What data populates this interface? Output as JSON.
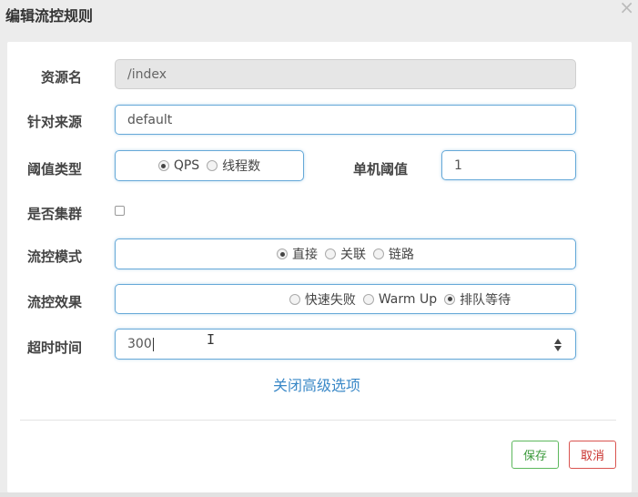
{
  "dialog": {
    "title": "编辑流控规则",
    "close_icon": "close-icon"
  },
  "form": {
    "resource": {
      "label": "资源名",
      "value": "/index"
    },
    "origin": {
      "label": "针对来源",
      "value": "default"
    },
    "threshold_type": {
      "label": "阈值类型",
      "options": [
        {
          "label": "QPS",
          "checked": true
        },
        {
          "label": "线程数",
          "checked": false
        }
      ]
    },
    "single_threshold": {
      "label": "单机阈值",
      "value": "1"
    },
    "cluster": {
      "label": "是否集群",
      "checked": false
    },
    "control_mode": {
      "label": "流控模式",
      "options": [
        {
          "label": "直接",
          "checked": true
        },
        {
          "label": "关联",
          "checked": false
        },
        {
          "label": "链路",
          "checked": false
        }
      ]
    },
    "control_effect": {
      "label": "流控效果",
      "options": [
        {
          "label": "快速失败",
          "checked": false
        },
        {
          "label": "Warm Up",
          "checked": false
        },
        {
          "label": "排队等待",
          "checked": true
        }
      ]
    },
    "timeout": {
      "label": "超时时间",
      "value": "300"
    }
  },
  "advanced_link": "关闭高级选项",
  "buttons": {
    "save": "保存",
    "cancel": "取消"
  },
  "colors": {
    "field_border": "#66a9d8",
    "link": "#3a88c7",
    "save": "#5cb85c",
    "cancel": "#d9534f"
  }
}
